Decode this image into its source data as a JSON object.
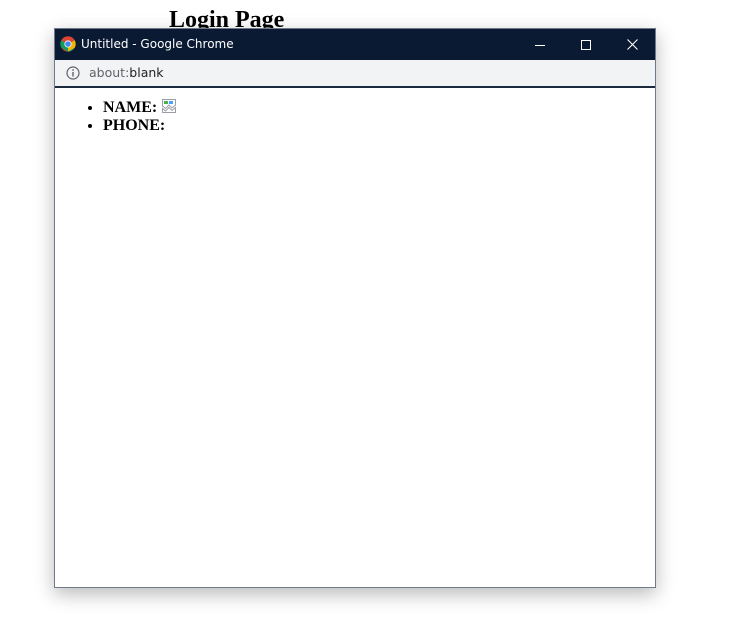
{
  "background": {
    "heading": "Login Page"
  },
  "window": {
    "title": "Untitled - Google Chrome",
    "controls": {
      "minimize_icon": "minimize-icon",
      "maximize_icon": "maximize-icon",
      "close_icon": "close-icon"
    },
    "address": {
      "scheme": "about:",
      "rest": "blank",
      "icon": "info-icon"
    }
  },
  "page": {
    "items": [
      {
        "label": "NAME:",
        "image": "broken-image-icon"
      },
      {
        "label": "PHONE:"
      }
    ]
  },
  "colors": {
    "titlebar": "#0b1a33",
    "addressbar": "#f1f3f4"
  }
}
